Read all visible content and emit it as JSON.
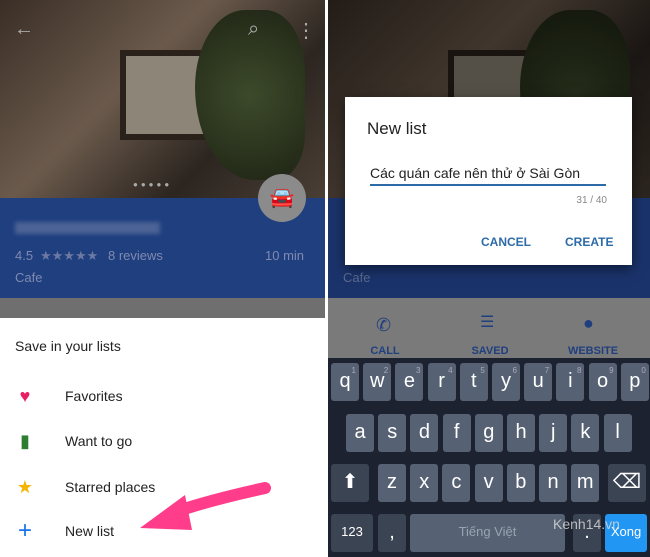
{
  "place": {
    "rating": "4.5",
    "stars": "★★★★★",
    "reviews": "8 reviews",
    "category": "Cafe",
    "travel_time": "10 min",
    "car_icon": "🚘"
  },
  "save_sheet": {
    "title": "Save in your lists",
    "items": [
      {
        "icon": "heart-icon",
        "glyph": "♥",
        "color": "#e91e63",
        "label": "Favorites"
      },
      {
        "icon": "bookmark-icon",
        "glyph": "▮",
        "color": "#2e7d32",
        "label": "Want to go"
      },
      {
        "icon": "star-icon",
        "glyph": "★",
        "color": "#f4b400",
        "label": "Starred places"
      },
      {
        "icon": "plus-icon",
        "glyph": "+",
        "color": "#1a73e8",
        "label": "New list"
      }
    ]
  },
  "dialog": {
    "title": "New list",
    "value": "Các quán cafe nên thử ở Sài Gòn",
    "counter": "31 / 40",
    "cancel": "CANCEL",
    "create": "CREATE"
  },
  "actions": {
    "call": "CALL",
    "saved": "SAVED",
    "website": "WEBSITE"
  },
  "keyboard": {
    "row1": [
      "q",
      "w",
      "e",
      "r",
      "t",
      "y",
      "u",
      "i",
      "o",
      "p"
    ],
    "nums": [
      "1",
      "2",
      "3",
      "4",
      "5",
      "6",
      "7",
      "8",
      "9",
      "0"
    ],
    "row2": [
      "a",
      "s",
      "d",
      "f",
      "g",
      "h",
      "j",
      "k",
      "l"
    ],
    "row3": [
      "z",
      "x",
      "c",
      "v",
      "b",
      "n",
      "m"
    ],
    "num_key": "123",
    "comma": ",",
    "space": "Tiếng Việt",
    "period": ".",
    "done": "Xong"
  },
  "watermark": "Kenh14.vn",
  "accent": "#e91e63"
}
